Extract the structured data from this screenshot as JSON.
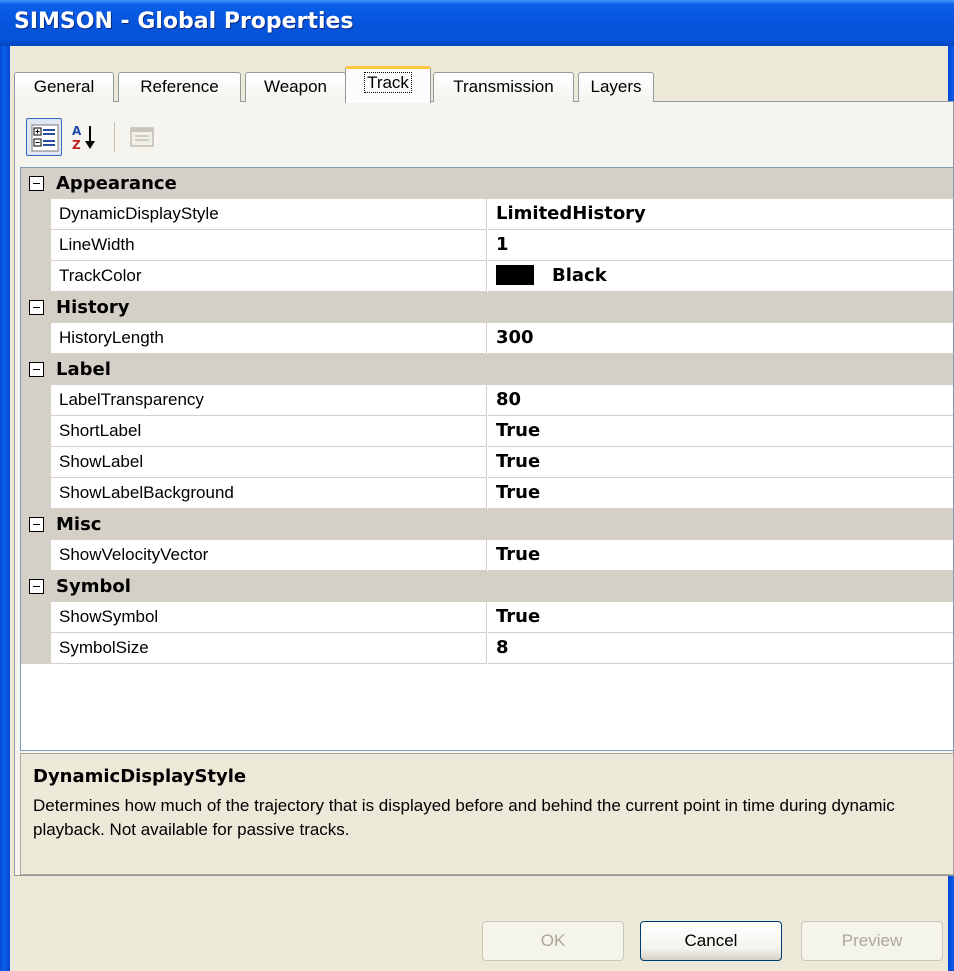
{
  "window": {
    "title": "SIMSON - Global Properties"
  },
  "tabs": [
    {
      "label": "General"
    },
    {
      "label": "Reference"
    },
    {
      "label": "Weapon"
    },
    {
      "label": "Track",
      "active": true
    },
    {
      "label": "Transmission"
    },
    {
      "label": "Layers"
    }
  ],
  "toolbar": {
    "buttons": [
      {
        "icon": "categorized-view-icon",
        "pressed": true
      },
      {
        "icon": "alphabetical-sort-icon",
        "pressed": false
      },
      {
        "icon": "property-pages-icon",
        "disabled": true
      }
    ]
  },
  "grid": {
    "categories": [
      {
        "name": "Appearance",
        "properties": [
          {
            "name": "DynamicDisplayStyle",
            "value": "LimitedHistory"
          },
          {
            "name": "LineWidth",
            "value": "1"
          },
          {
            "name": "TrackColor",
            "value": "Black",
            "swatch": "#000000"
          }
        ]
      },
      {
        "name": "History",
        "properties": [
          {
            "name": "HistoryLength",
            "value": "300"
          }
        ]
      },
      {
        "name": "Label",
        "properties": [
          {
            "name": "LabelTransparency",
            "value": "80"
          },
          {
            "name": "ShortLabel",
            "value": "True"
          },
          {
            "name": "ShowLabel",
            "value": "True"
          },
          {
            "name": "ShowLabelBackground",
            "value": "True"
          }
        ]
      },
      {
        "name": "Misc",
        "properties": [
          {
            "name": "ShowVelocityVector",
            "value": "True"
          }
        ]
      },
      {
        "name": "Symbol",
        "properties": [
          {
            "name": "ShowSymbol",
            "value": "True"
          },
          {
            "name": "SymbolSize",
            "value": "8"
          }
        ]
      }
    ]
  },
  "description": {
    "title": "DynamicDisplayStyle",
    "text": "Determines how much of the trajectory that is displayed before and behind the current point in time during dynamic playback. Not available for passive tracks."
  },
  "buttons": {
    "ok": "OK",
    "cancel": "Cancel",
    "preview": "Preview"
  },
  "colors": {
    "titlebar": "#0654dc",
    "window_bg": "#ece9d8",
    "category_bg": "#d4d0c8",
    "active_tab_accent": "#ffc83c"
  }
}
